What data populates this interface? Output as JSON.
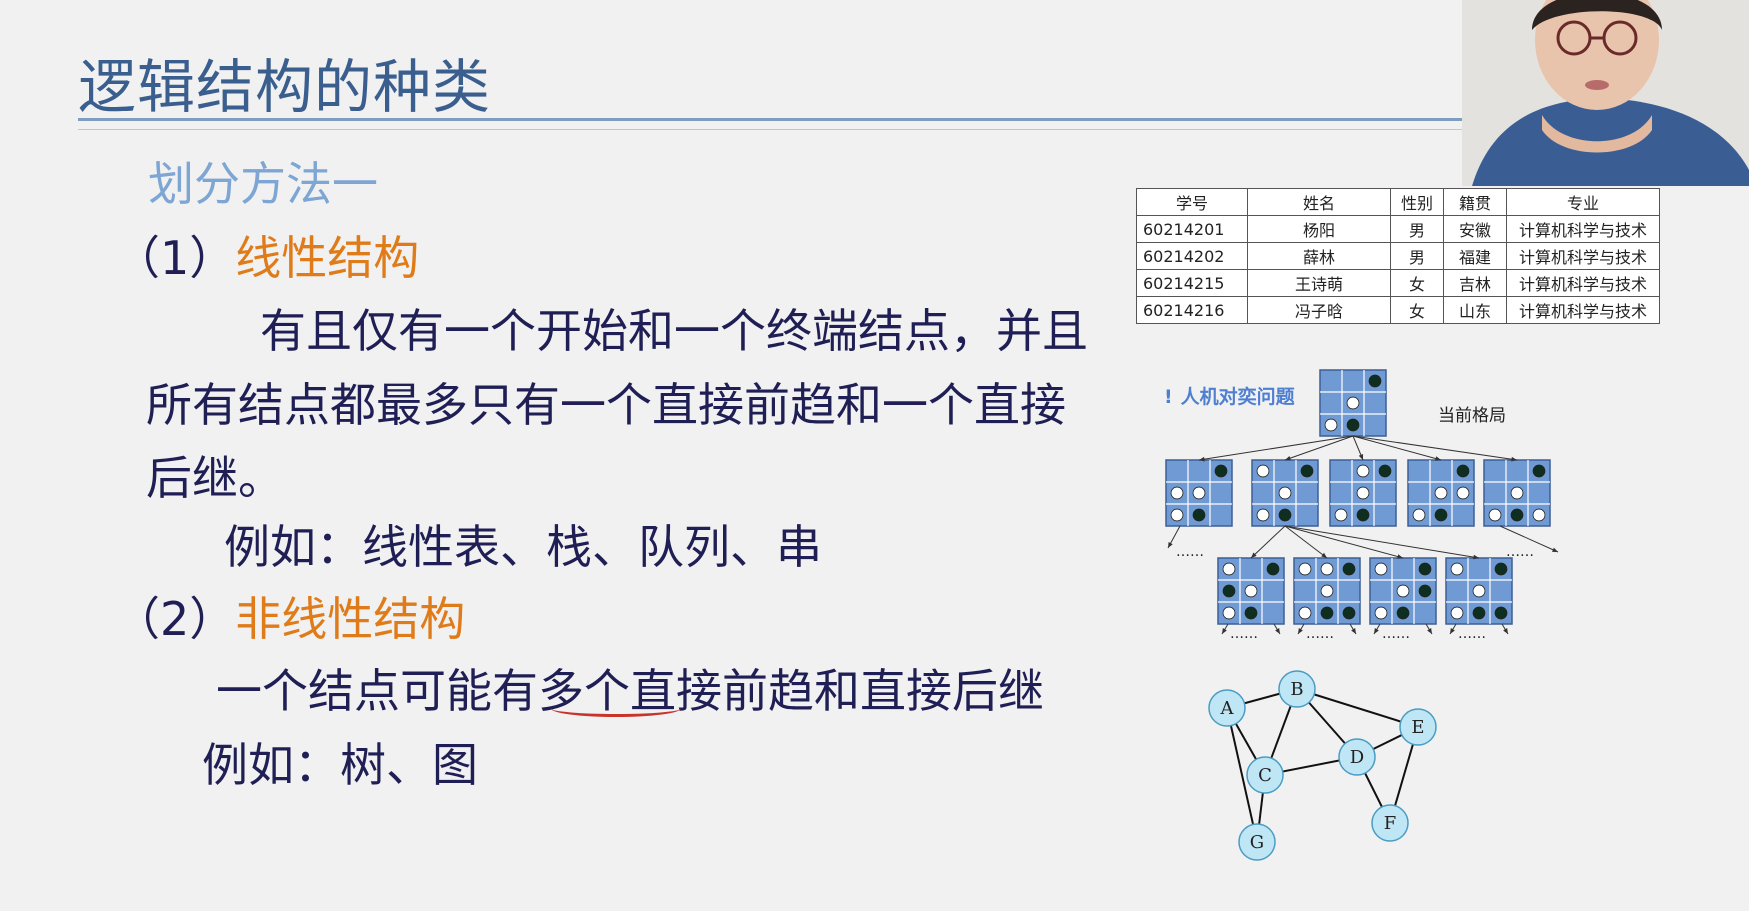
{
  "slide": {
    "title": "逻辑结构的种类",
    "subtitle": "划分方法一",
    "section1": {
      "number": "（1）",
      "heading": "线性结构",
      "desc_line1": "有且仅有一个开始和一个终端结点，并且",
      "desc_line2": "所有结点都最多只有一个直接前趋和一个直接",
      "desc_line3": "后继。",
      "example": "例如：线性表、栈、队列、串"
    },
    "section2": {
      "number": "（2）",
      "heading": "非线性结构",
      "desc_before": "一个结点可能有",
      "desc_underlined": "多个",
      "desc_after": "直接前趋和直接后继",
      "example": "例如：树、图"
    }
  },
  "student_table": {
    "headers": [
      "学号",
      "姓名",
      "性别",
      "籍贯",
      "专业"
    ],
    "rows": [
      [
        "60214201",
        "杨阳",
        "男",
        "安徽",
        "计算机科学与技术"
      ],
      [
        "60214202",
        "薛林",
        "男",
        "福建",
        "计算机科学与技术"
      ],
      [
        "60214215",
        "王诗萌",
        "女",
        "吉林",
        "计算机科学与技术"
      ],
      [
        "60214216",
        "冯子晗",
        "女",
        "山东",
        "计算机科学与技术"
      ]
    ]
  },
  "game_tree": {
    "label_prefix": "!",
    "label": "人机对奕问题",
    "board_label": "当前格局",
    "ellipsis": "……"
  },
  "graph": {
    "nodes": [
      "A",
      "B",
      "C",
      "D",
      "E",
      "F",
      "G"
    ],
    "edges": [
      [
        "A",
        "B"
      ],
      [
        "A",
        "C"
      ],
      [
        "A",
        "G"
      ],
      [
        "B",
        "C"
      ],
      [
        "B",
        "D"
      ],
      [
        "B",
        "E"
      ],
      [
        "C",
        "D"
      ],
      [
        "C",
        "G"
      ],
      [
        "D",
        "E"
      ],
      [
        "D",
        "F"
      ],
      [
        "E",
        "F"
      ]
    ]
  },
  "colors": {
    "title": "#3a5f8f",
    "subtitle": "#7ea6d4",
    "body_text": "#1f1f55",
    "heading_accent": "#e07b1a",
    "underline": "#c8332b",
    "board_fill": "#6f9ad4",
    "node_fill": "#bfe6f5"
  }
}
